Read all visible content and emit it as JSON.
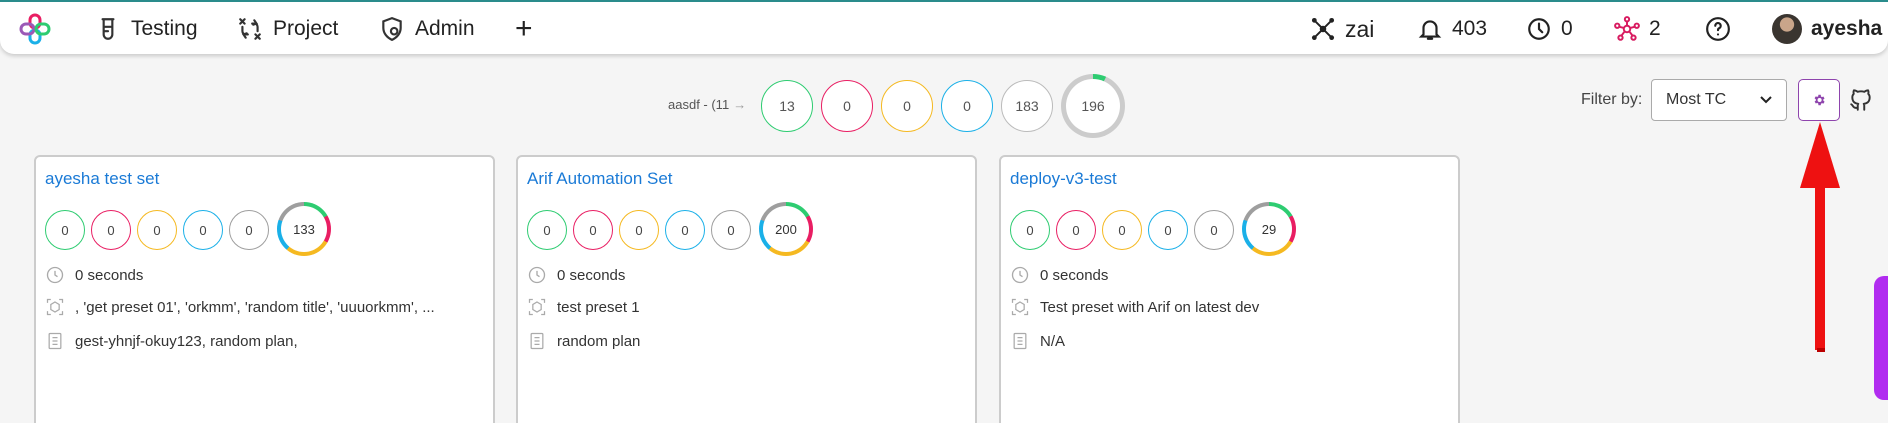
{
  "nav": {
    "items": [
      {
        "label": "Testing",
        "icon": "beaker-icon"
      },
      {
        "label": "Project",
        "icon": "workflow-icon"
      },
      {
        "label": "Admin",
        "icon": "shield-gear-icon"
      }
    ],
    "add_label": "+",
    "right": {
      "ai_label": "zai",
      "notifications": "403",
      "running": "0",
      "nodes": "2",
      "help": "?",
      "user": "ayesha"
    }
  },
  "summary": {
    "label": "aasdf - (11",
    "arrow": "→",
    "counts": [
      "13",
      "0",
      "0",
      "0",
      "183"
    ],
    "total": "196"
  },
  "filter": {
    "label": "Filter by:",
    "selected": "Most TC"
  },
  "colors": {
    "pass": "#2ecc71",
    "fail": "#e91e63",
    "warn": "#f5b921",
    "info": "#1ab0e8",
    "neutral": "#9e9e9e",
    "link": "#1a7ad6",
    "accent": "#8e44ad",
    "annotation": "#ee1111",
    "side_tab": "#b12cf0"
  },
  "cards": [
    {
      "title": "ayesha test set",
      "counts": [
        "0",
        "0",
        "0",
        "0",
        "0"
      ],
      "total": "133",
      "duration": "0 seconds",
      "presets": ", 'get preset 01', 'orkmm', 'random title', 'uuuorkmm', ...",
      "plans": "gest-yhnjf-okuy123, random plan,"
    },
    {
      "title": "Arif Automation Set",
      "counts": [
        "0",
        "0",
        "0",
        "0",
        "0"
      ],
      "total": "200",
      "duration": "0 seconds",
      "presets": "test preset 1",
      "plans": "random plan"
    },
    {
      "title": "deploy-v3-test",
      "counts": [
        "0",
        "0",
        "0",
        "0",
        "0"
      ],
      "total": "29",
      "duration": "0 seconds",
      "presets": "Test preset with Arif on latest dev",
      "plans": "N/A"
    }
  ]
}
